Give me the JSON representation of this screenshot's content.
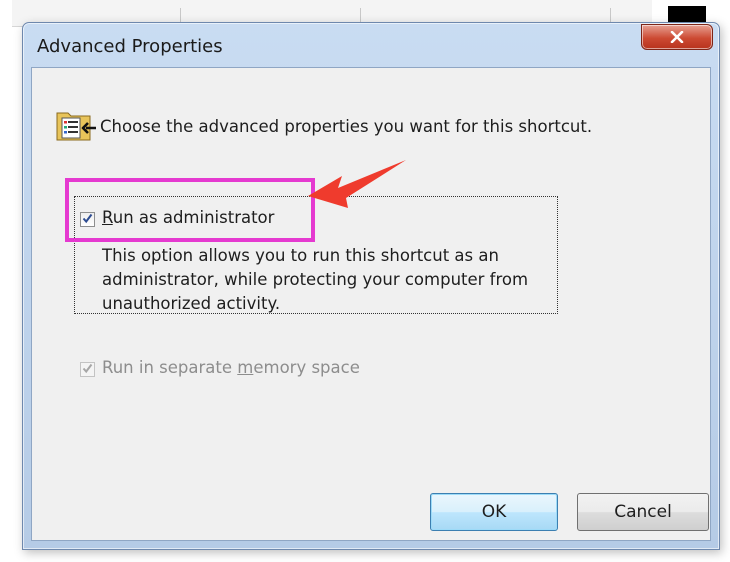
{
  "dialog": {
    "title": "Advanced Properties",
    "close_label": "x",
    "description": "Choose the advanced properties you want for this shortcut.",
    "run_as_admin": {
      "label_first": "R",
      "label_rest": "un as administrator",
      "checked": true,
      "help_text": "This option allows you to run this shortcut as an administrator, while protecting your computer from unauthorized activity."
    },
    "separate_memory": {
      "label_before": "Run in separate ",
      "label_accel": "m",
      "label_after": "emory space",
      "checked": true,
      "enabled": false
    },
    "ok_label": "OK",
    "cancel_label": "Cancel"
  },
  "colors": {
    "highlight": "#e53ad0",
    "arrow": "#ef3b2d"
  }
}
